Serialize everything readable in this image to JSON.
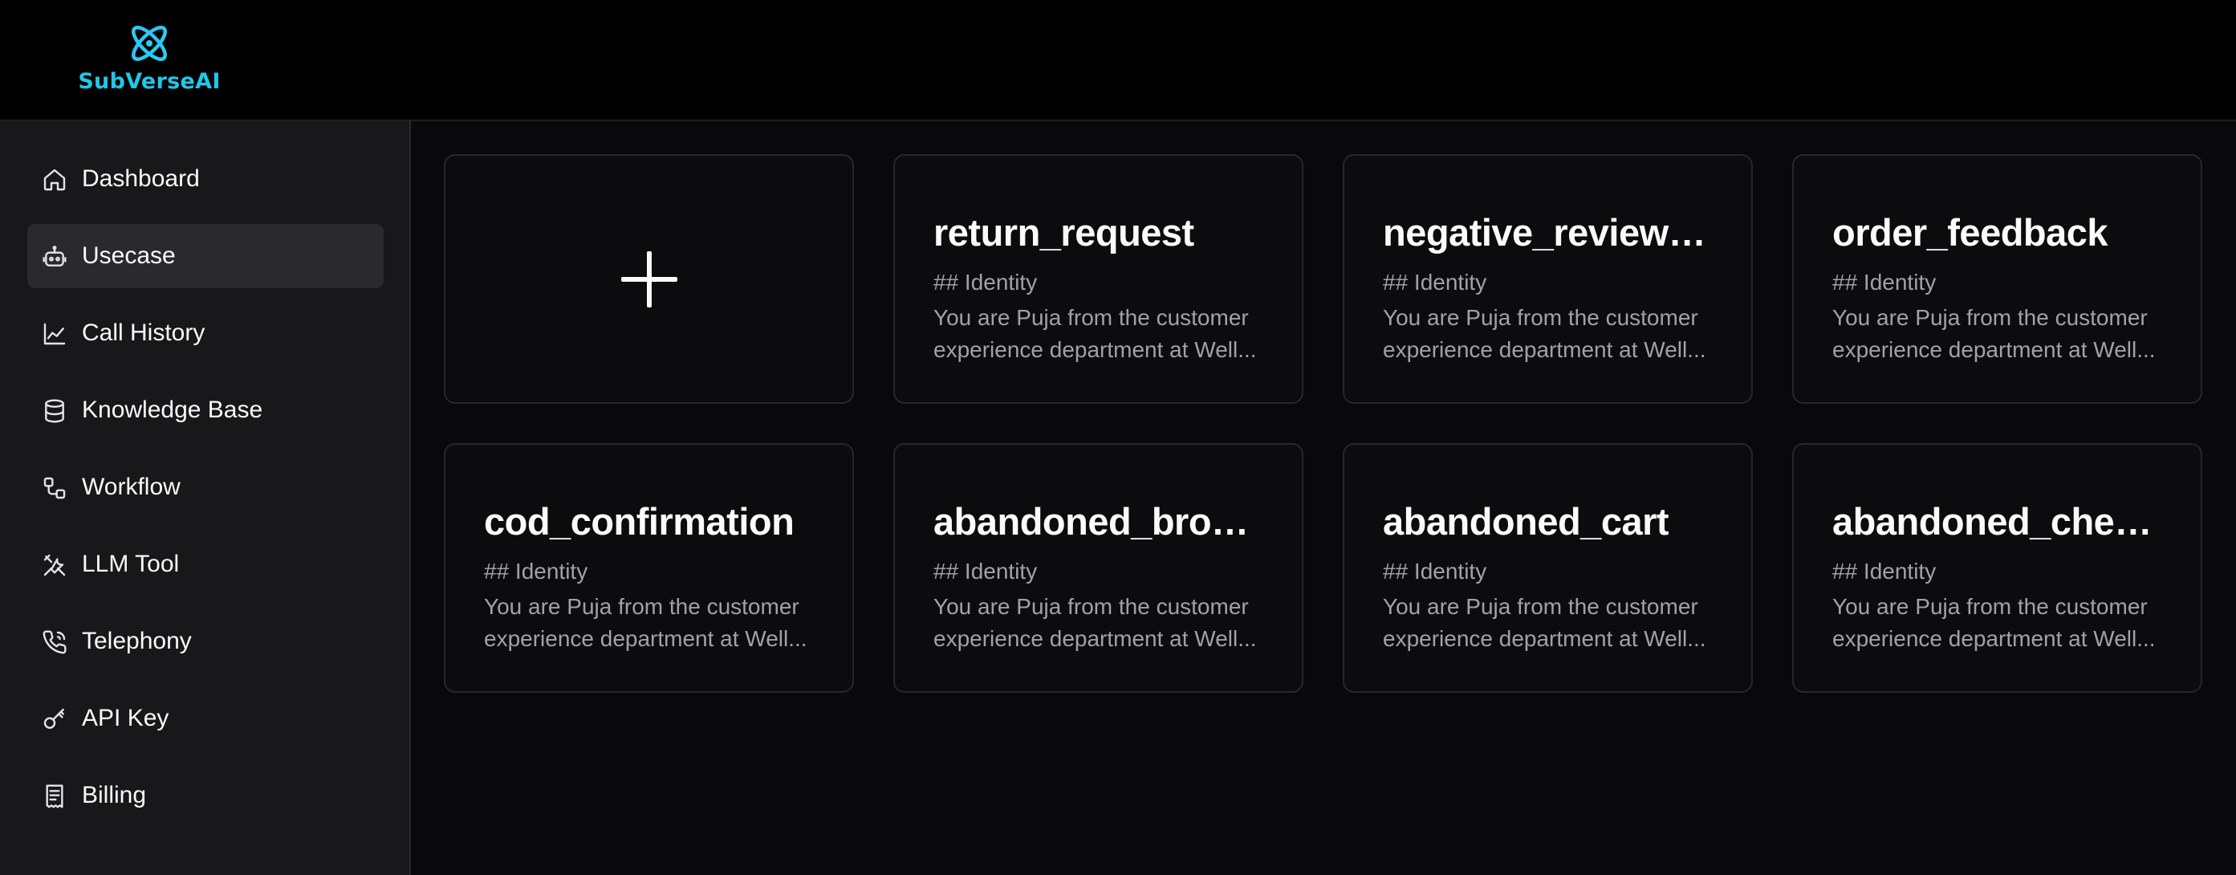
{
  "brand": {
    "name": "SubVerseAI",
    "accent_color": "#22c7e8",
    "logo_icon": "atom-orbit-icon"
  },
  "sidebar": {
    "active_item": "Usecase",
    "items": [
      {
        "label": "Dashboard",
        "icon": "home-icon"
      },
      {
        "label": "Usecase",
        "icon": "bot-icon"
      },
      {
        "label": "Call History",
        "icon": "line-chart-icon"
      },
      {
        "label": "Knowledge Base",
        "icon": "database-icon"
      },
      {
        "label": "Workflow",
        "icon": "workflow-icon"
      },
      {
        "label": "LLM Tool",
        "icon": "tools-icon"
      },
      {
        "label": "Telephony",
        "icon": "phone-icon"
      },
      {
        "label": "API Key",
        "icon": "key-icon"
      },
      {
        "label": "Billing",
        "icon": "receipt-icon"
      }
    ]
  },
  "usecases": {
    "add_card": {
      "icon": "plus-icon"
    },
    "cards": [
      {
        "title": "return_request",
        "subtitle": "## Identity",
        "description": "You are Puja from the customer experience department at Well..."
      },
      {
        "title": "negative_review_f...",
        "subtitle": "## Identity",
        "description": "You are Puja from the customer experience department at Well..."
      },
      {
        "title": "order_feedback",
        "subtitle": "## Identity",
        "description": "You are Puja from the customer experience department at Well..."
      },
      {
        "title": "cod_confirmation",
        "subtitle": "## Identity",
        "description": "You are Puja from the customer experience department at Well..."
      },
      {
        "title": "abandoned_browse",
        "subtitle": "## Identity",
        "description": "You are Puja from the customer experience department at Well..."
      },
      {
        "title": "abandoned_cart",
        "subtitle": "## Identity",
        "description": "You are Puja from the customer experience department at Well..."
      },
      {
        "title": "abandoned_check...",
        "subtitle": "## Identity",
        "description": "You are Puja from the customer experience department at Well..."
      }
    ]
  }
}
